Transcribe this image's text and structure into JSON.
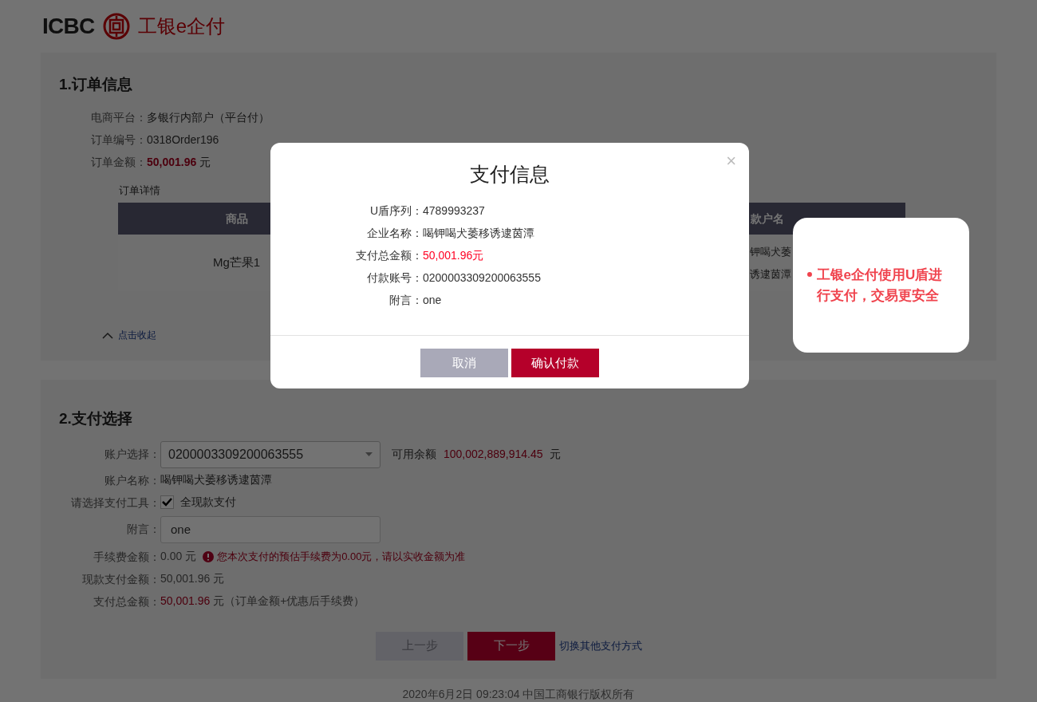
{
  "logo": {
    "wordmark": "ICBC",
    "product": "工银e企付"
  },
  "order_section": {
    "title": "1.订单信息",
    "fields": [
      {
        "label": "电商平台：",
        "value": "多银行内部户（平台付）",
        "kind": "plain"
      },
      {
        "label": "订单编号：",
        "value": "0318Order196",
        "kind": "plain"
      },
      {
        "label": "订单金额：",
        "value": "50,001.96",
        "unit": "元",
        "kind": "amount"
      }
    ],
    "details_title": "订单详情",
    "table": {
      "columns": [
        "商品",
        "款户名"
      ],
      "rows": [
        {
          "cells": [
            [
              "Mg芒果1"
            ],
            [
              "钾喝犬萎",
              "诱逮茵潭"
            ]
          ]
        }
      ]
    },
    "collapse_link": "点击收起"
  },
  "payment_section": {
    "title": "2.支付选择",
    "account": {
      "label": "账户选择：",
      "value": "0200003309200063555",
      "balance_label": "可用余额",
      "balance": "100,002,889,914.45",
      "balance_unit": "元"
    },
    "account_name": {
      "label": "账户名称：",
      "value": "喝钾喝犬萎移诱逮茵潭"
    },
    "tool": {
      "label": "请选择支付工具：",
      "option": "全现款支付",
      "checked": true
    },
    "note": {
      "label": "附言：",
      "value": "one"
    },
    "fee": {
      "label": "手续费金额：",
      "value": "0.00 元",
      "warning": "您本次支付的预估手续费为0.00元，请以实收金额为准"
    },
    "cash": {
      "label": "现款支付金额：",
      "value": "50,001.96 元"
    },
    "total": {
      "label": "支付总金额：",
      "value": "50,001.96",
      "suffix": "元（订单金额+优惠后手续费）"
    },
    "buttons": [
      {
        "label": "上一步",
        "disabled": true
      },
      {
        "label": "下一步",
        "disabled": false
      }
    ],
    "switch_link": "切换其他支付方式"
  },
  "footer": "2020年6月2日 09:23:04 中国工商银行版权所有",
  "modal": {
    "title": "支付信息",
    "close": "×",
    "rows": [
      {
        "label": "U盾序列：",
        "value": "4789993237",
        "kind": "plain"
      },
      {
        "label": "企业名称：",
        "value": "喝钾喝犬萎移诱逮茵潭",
        "kind": "plain"
      },
      {
        "label": "支付总金额：",
        "value": "50,001.96元",
        "kind": "amount"
      },
      {
        "label": "付款账号：",
        "value": "0200003309200063555",
        "kind": "plain"
      },
      {
        "label": "附言：",
        "value": "one",
        "kind": "plain"
      }
    ],
    "cancel": "取消",
    "confirm": "确认付款"
  },
  "tip": {
    "text": "工银e企付使用U盾进行支付，交易更安全"
  }
}
